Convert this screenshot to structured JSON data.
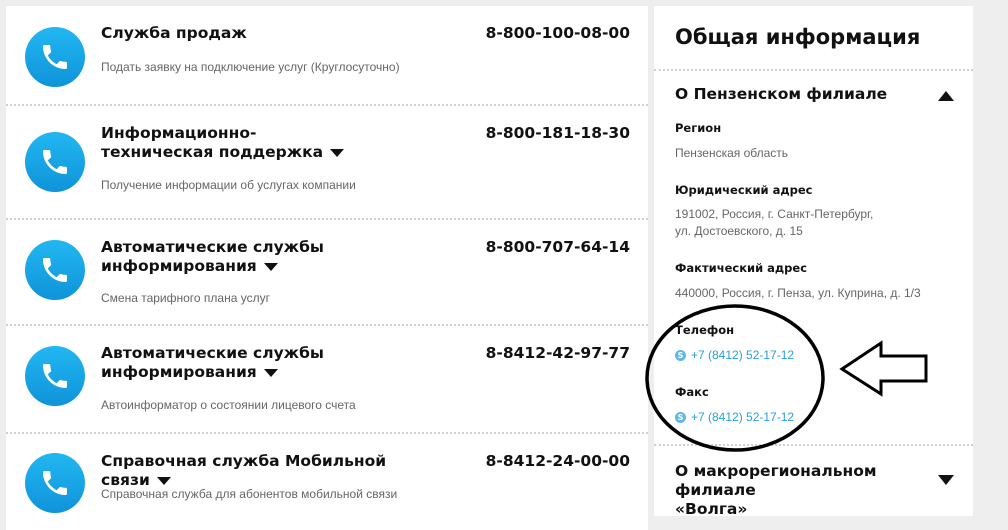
{
  "services": [
    {
      "title": "Служба продаж",
      "has_caret": false,
      "desc": "Подать заявку на подключение услуг (Круглосуточно)",
      "number": "8-800-100-08-00"
    },
    {
      "title": "Информационно-техническая поддержка",
      "has_caret": true,
      "desc": "Получение информации об услугах компании",
      "number": "8-800-181-18-30"
    },
    {
      "title": "Автоматические службы информирования",
      "has_caret": true,
      "desc": "Смена тарифного плана услуг",
      "number": "8-800-707-64-14"
    },
    {
      "title": "Автоматические службы информирования",
      "has_caret": true,
      "desc": "Автоинформатор о состоянии лицевого счета",
      "number": "8-8412-42-97-77"
    },
    {
      "title": "Справочная служба Мобильной связи",
      "has_caret": true,
      "desc": "Справочная служба для абонентов мобильной связи",
      "number": "8-8412-24-00-00"
    }
  ],
  "info": {
    "title": "Общая информация",
    "branch": {
      "heading": "О Пензенском филиале",
      "region_label": "Регион",
      "region_value": "Пензенская область",
      "legal_label": "Юридический адрес",
      "legal_line1": "191002, Россия, г. Санкт-Петербург,",
      "legal_line2": "ул. Достоевского, д. 15",
      "actual_label": "Фактический адрес",
      "actual_value": "440000, Россия, г. Пенза, ул. Куприна, д. 1/3",
      "phone_label": "Телефон",
      "phone_value": "+7 (8412) 52-17-12",
      "fax_label": "Факс",
      "fax_value": "+7 (8412) 52-17-12"
    },
    "macro_heading_line1": "О макрорегиональном филиале",
    "macro_heading_line2": "«Волга»"
  },
  "colors": {
    "phone_icon_bg": "#1aa6e6",
    "link": "#2aa0d8",
    "annotation": "#000000"
  },
  "icons": {
    "service": "phone-icon",
    "skype": "skype-icon",
    "expand": "chevron-down-icon",
    "collapse": "chevron-up-icon"
  }
}
